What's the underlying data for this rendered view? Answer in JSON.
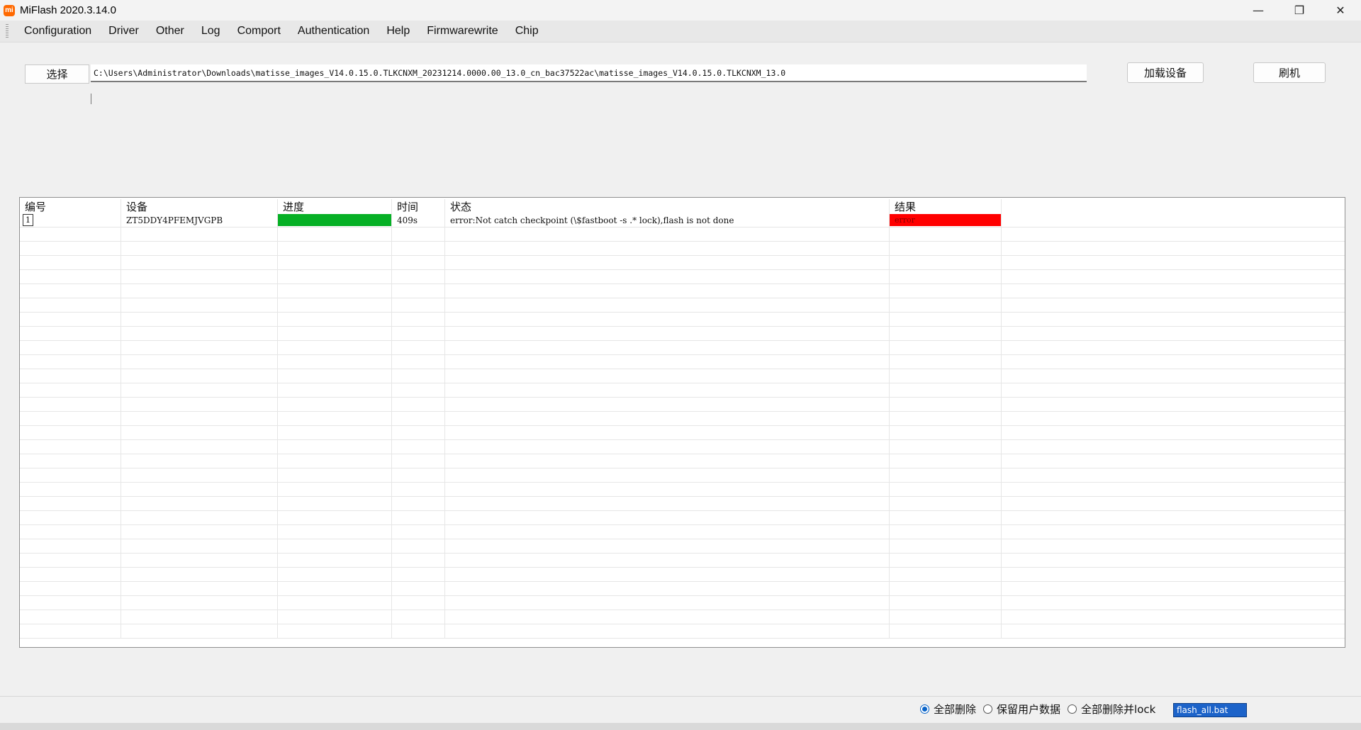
{
  "window": {
    "title": "MiFlash 2020.3.14.0",
    "icon_text": "mi",
    "controls": {
      "minimize": "—",
      "restore": "❐",
      "close": "✕"
    }
  },
  "menu": {
    "items": [
      "Configuration",
      "Driver",
      "Other",
      "Log",
      "Comport",
      "Authentication",
      "Help",
      "Firmwarewrite",
      "Chip"
    ]
  },
  "toolbar": {
    "select_label": "选择",
    "path_value": "C:\\Users\\Administrator\\Downloads\\matisse_images_V14.0.15.0.TLKCNXM_20231214.0000.00_13.0_cn_bac37522ac\\matisse_images_V14.0.15.0.TLKCNXM_13.0",
    "load_label": "加载设备",
    "flash_label": "刷机"
  },
  "table": {
    "headers": [
      "编号",
      "设备",
      "进度",
      "时间",
      "状态",
      "结果"
    ],
    "rows": [
      {
        "index": "1",
        "device": "ZT5DDY4PFEMJVGPB",
        "progress": 1.0,
        "time": "409s",
        "status": "error:Not catch checkpoint (\\$fastboot -s .* lock),flash is not done",
        "result": "error"
      }
    ]
  },
  "bottom": {
    "options": [
      "全部删除",
      "保留用户数据",
      "全部删除并lock"
    ],
    "selected_option": 0,
    "flash_mode_label": "flash_all.bat"
  },
  "colors": {
    "progress": "#06b025",
    "error": "#ff0000",
    "accent": "#0a64c8"
  }
}
